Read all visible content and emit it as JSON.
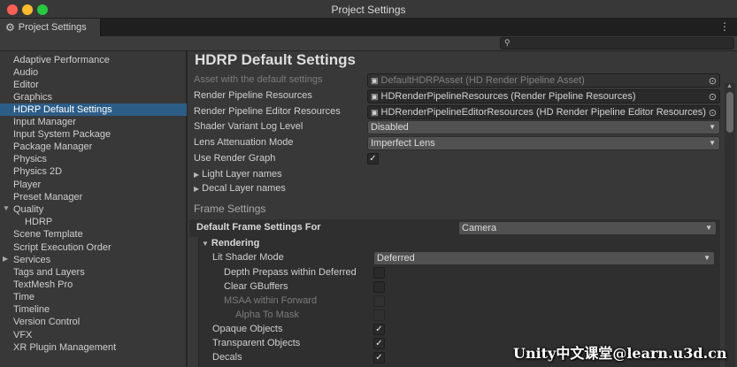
{
  "window": {
    "title": "Project Settings"
  },
  "tab": {
    "label": "Project Settings"
  },
  "search": {
    "placeholder": ""
  },
  "sidebar": {
    "items": [
      "Adaptive Performance",
      "Audio",
      "Editor",
      "Graphics",
      "HDRP Default Settings",
      "Input Manager",
      "Input System Package",
      "Package Manager",
      "Physics",
      "Physics 2D",
      "Player",
      "Preset Manager",
      "Quality",
      "HDRP",
      "Scene Template",
      "Script Execution Order",
      "Services",
      "Tags and Layers",
      "TextMesh Pro",
      "Time",
      "Timeline",
      "Version Control",
      "VFX",
      "XR Plugin Management"
    ]
  },
  "main": {
    "title": "HDRP Default Settings",
    "asset": {
      "label": "Asset with the default settings",
      "value": "DefaultHDRPAsset (HD Render Pipeline Asset)"
    },
    "resources": {
      "label": "Render Pipeline Resources",
      "value": "HDRenderPipelineResources (Render Pipeline Resources)"
    },
    "editor_resources": {
      "label": "Render Pipeline Editor Resources",
      "value": "HDRenderPipelineEditorResources (HD Render Pipeline Editor Resources)"
    },
    "shader_log": {
      "label": "Shader Variant Log Level",
      "value": "Disabled"
    },
    "lens": {
      "label": "Lens Attenuation Mode",
      "value": "Imperfect Lens"
    },
    "render_graph": {
      "label": "Use Render Graph",
      "checked": "✓"
    },
    "light_layers": {
      "label": "Light Layer names"
    },
    "decal_layers": {
      "label": "Decal Layer names"
    },
    "frame_settings_header": "Frame Settings",
    "default_frame": {
      "label": "Default Frame Settings For",
      "value": "Camera"
    },
    "rendering": {
      "label": "Rendering"
    },
    "lit_shader": {
      "label": "Lit Shader Mode",
      "value": "Deferred"
    },
    "depth_prepass": {
      "label": "Depth Prepass within Deferred",
      "checked": ""
    },
    "clear_gbuffers": {
      "label": "Clear GBuffers",
      "checked": ""
    },
    "msaa": {
      "label": "MSAA within Forward",
      "checked": ""
    },
    "alpha_to_mask": {
      "label": "Alpha To Mask",
      "checked": ""
    },
    "opaque": {
      "label": "Opaque Objects",
      "checked": "✓"
    },
    "transparent": {
      "label": "Transparent Objects",
      "checked": "✓"
    },
    "decals": {
      "label": "Decals",
      "checked": "✓"
    }
  },
  "watermark": "Unity中文课堂@learn.u3d.cn",
  "icons": {
    "gear": "⚙",
    "menu": "⋮",
    "search": "🔍",
    "object": "▣",
    "picker": "⊙",
    "dropdown": "▼",
    "fold_closed": "▶",
    "fold_open": "▼",
    "scroll_up": "▲"
  },
  "colors": {
    "selection": "#2c5d87",
    "panel": "#383838",
    "field": "#2a2a2a"
  }
}
